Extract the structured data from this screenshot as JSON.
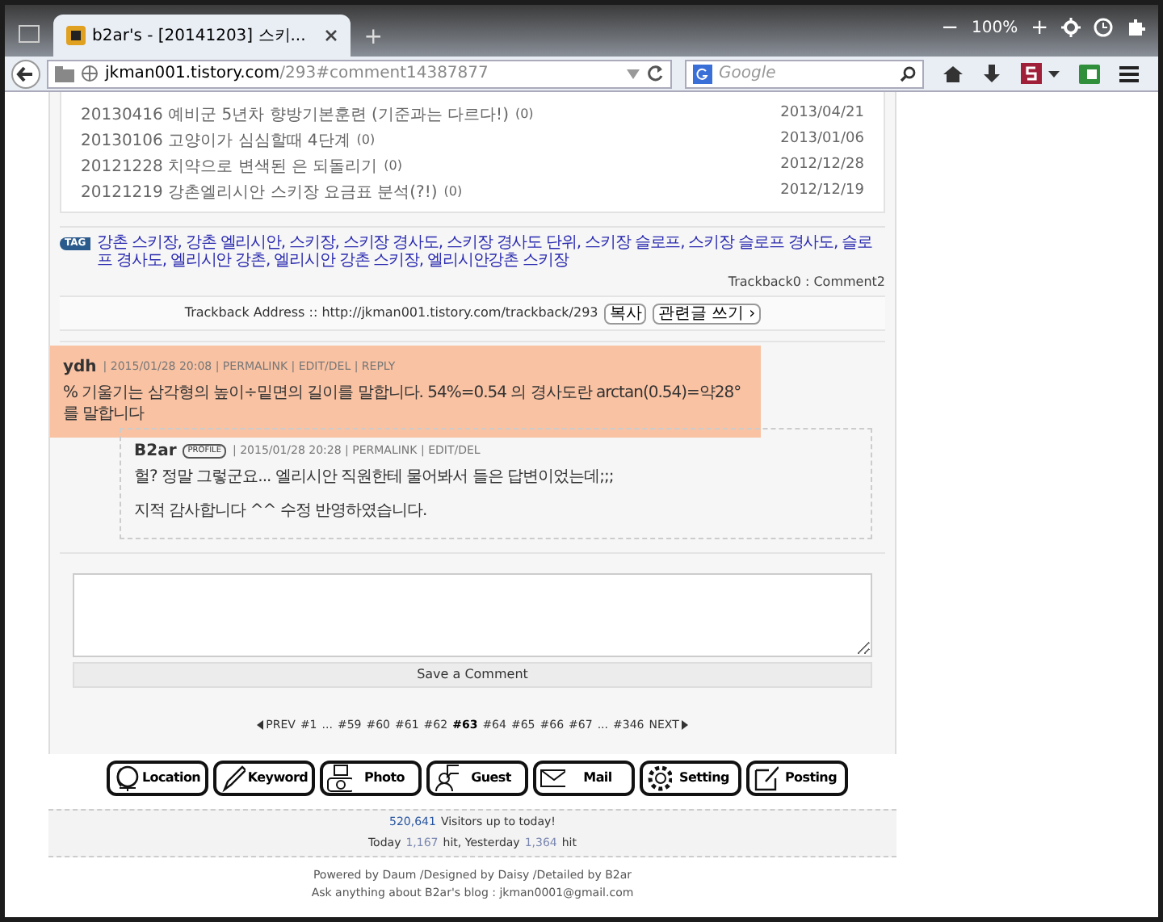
{
  "browser": {
    "tab_title": "b2ar's - [20141203] 스키...",
    "new_tab": "+",
    "zoom": {
      "minus": "−",
      "value": "100%",
      "plus": "+"
    },
    "url": {
      "host": "jkman001.tistory.com",
      "path": "/293#comment14387877"
    },
    "search": {
      "placeholder": "Google"
    }
  },
  "posts": [
    {
      "title": "20130416 예비군 5년차 향방기본훈련 (기준과는 다르다!)",
      "count": "(0)",
      "date": "2013/04/21"
    },
    {
      "title": "20130106 고양이가 심심할때 4단계",
      "count": "(0)",
      "date": "2013/01/06"
    },
    {
      "title": "20121228 치약으로 변색된 은 되돌리기",
      "count": "(0)",
      "date": "2012/12/28"
    },
    {
      "title": "20121219 강촌엘리시안 스키장 요금표 분석(?!)",
      "count": "(0)",
      "date": "2012/12/19"
    }
  ],
  "tags": {
    "badge": "TAG",
    "text": "강촌 스키장, 강촌 엘리시안, 스키장, 스키장 경사도, 스키장 경사도 단위, 스키장 슬로프, 스키장 슬로프 경사도, 슬로프 경사도, 엘리시안 강촌, 엘리시안 강촌 스키장, 엘리시안강촌 스키장"
  },
  "counts": "Trackback0 : Comment2",
  "trackback": {
    "label": "Trackback Address :: http://jkman001.tistory.com/trackback/293",
    "buttons": [
      "복사",
      "관련글 쓰기 ›"
    ]
  },
  "comments": [
    {
      "author": "ydh",
      "meta": "| 2015/01/28 20:08 | PERMALINK | EDIT/DEL | REPLY",
      "highlighted": true,
      "lines": [
        "% 기울기는 삼각형의 높이÷밑면의 길이를 말합니다. 54%=0.54 의 경사도란 arctan(0.54)=약28°를 말합니다"
      ],
      "children": [
        {
          "author": "B2ar",
          "badge": "PROFILE",
          "meta": "| 2015/01/28 20:28 | PERMALINK | EDIT/DEL",
          "highlighted": false,
          "lines": [
            "헐? 정말 그렇군요... 엘리시안 직원한테 물어봐서 들은 답변이었는데;;;",
            "지적 감사합니다 ^^ 수정 반영하였습니다."
          ]
        }
      ]
    }
  ],
  "comment_form": {
    "submit": "Save a Comment"
  },
  "pagination": [
    {
      "label": "PREV",
      "kind": "prev",
      "selected": false
    },
    {
      "label": "#1",
      "kind": "page",
      "selected": false
    },
    {
      "label": "...",
      "kind": "gap",
      "selected": false
    },
    {
      "label": "#59",
      "kind": "page",
      "selected": false
    },
    {
      "label": "#60",
      "kind": "page",
      "selected": false
    },
    {
      "label": "#61",
      "kind": "page",
      "selected": false
    },
    {
      "label": "#62",
      "kind": "page",
      "selected": false
    },
    {
      "label": "#63",
      "kind": "page",
      "selected": true
    },
    {
      "label": "#64",
      "kind": "page",
      "selected": false
    },
    {
      "label": "#65",
      "kind": "page",
      "selected": false
    },
    {
      "label": "#66",
      "kind": "page",
      "selected": false
    },
    {
      "label": "#67",
      "kind": "page",
      "selected": false
    },
    {
      "label": "...",
      "kind": "gap",
      "selected": false
    },
    {
      "label": "#346",
      "kind": "page",
      "selected": false
    },
    {
      "label": "NEXT",
      "kind": "next",
      "selected": false
    }
  ],
  "nav_buttons": [
    "Location",
    "Keyword",
    "Photo",
    "Guest",
    "Mail",
    "Setting",
    "Posting"
  ],
  "visitors": {
    "total": "520,641",
    "total_label": "Visitors up to today!",
    "today_label": "Today",
    "today": "1,167",
    "today_unit": "hit, Yesterday",
    "yesterday": "1,364",
    "yesterday_unit": "hit"
  },
  "footer": [
    "Powered by Daum /Designed by Daisy /Detailed by B2ar",
    "Ask anything about B2ar's blog : jkman0001@gmail.com"
  ]
}
